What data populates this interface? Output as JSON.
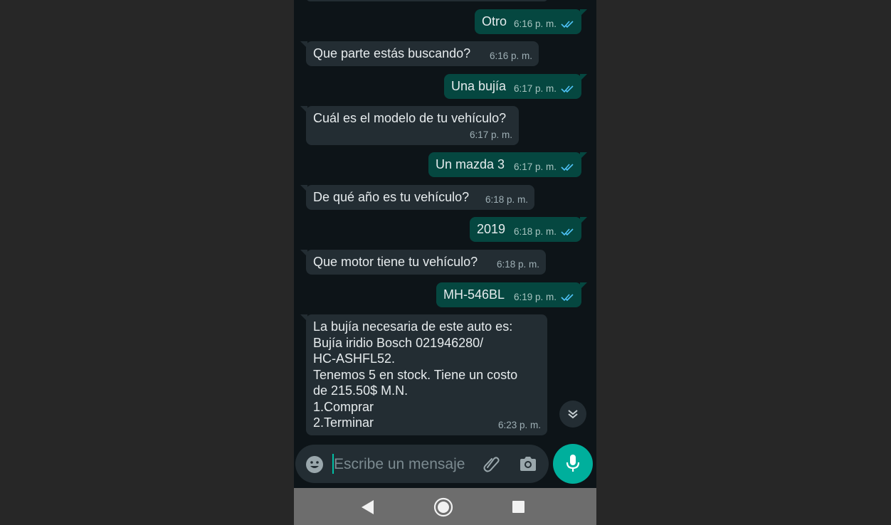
{
  "messages": [
    {
      "dir": "out",
      "text": "Otro",
      "time": "6:16 p. m."
    },
    {
      "dir": "in",
      "text": "Que parte estás buscando?",
      "time": "6:16 p. m."
    },
    {
      "dir": "out",
      "text": "Una bujía",
      "time": "6:17 p. m."
    },
    {
      "dir": "in",
      "text": "Cuál es el modelo de tu vehículo?",
      "time": "6:17 p. m."
    },
    {
      "dir": "out",
      "text": "Un mazda 3",
      "time": "6:17 p. m."
    },
    {
      "dir": "in",
      "text": "De qué año es tu vehículo?",
      "time": "6:18 p. m."
    },
    {
      "dir": "out",
      "text": "2019",
      "time": "6:18 p. m."
    },
    {
      "dir": "in",
      "text": "Que motor tiene tu vehículo?",
      "time": "6:18 p. m."
    },
    {
      "dir": "out",
      "text": "MH-546BL",
      "time": "6:19 p. m."
    },
    {
      "dir": "in",
      "text": "La bujía necesaria de este auto es:\nBujía iridio Bosch 021946280/\nHC-ASHFL52.\nTenemos 5 en stock. Tiene un costo\nde 215.50$ M.N.\n1.Comprar\n2.Terminar",
      "time": "6:23 p. m."
    }
  ],
  "composer": {
    "placeholder": "Escribe un mensaje"
  },
  "icons": {
    "emoji": "emoji-icon",
    "attach": "paperclip-icon",
    "camera": "camera-icon",
    "mic": "microphone-icon",
    "scroll_down": "double-chevron-down-icon",
    "read_receipt": "double-check-icon",
    "nav_back": "triangle-back-icon",
    "nav_home": "circle-home-icon",
    "nav_recent": "square-recents-icon"
  },
  "colors": {
    "background": "#0d1418",
    "incoming_bubble": "#232d33",
    "outgoing_bubble": "#054740",
    "accent": "#00af9c",
    "read_tick": "#4fc3f7"
  }
}
